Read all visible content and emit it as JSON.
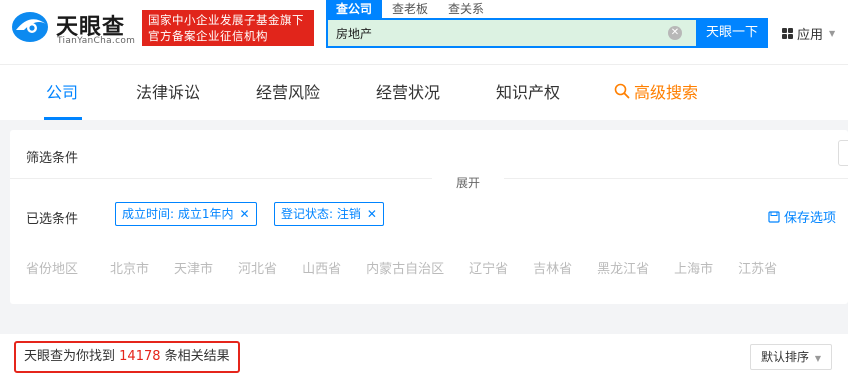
{
  "header": {
    "logo_text": "天眼查",
    "logo_sub": "TianYanCha.com",
    "badge_line1": "国家中小企业发展子基金旗下",
    "badge_line2": "官方备案企业征信机构",
    "search_tabs": [
      {
        "label": "查公司"
      },
      {
        "label": "查老板"
      },
      {
        "label": "查关系"
      }
    ],
    "search_value": "房地产",
    "clear_symbol": "✕",
    "search_button": "天眼一下",
    "apps_label": "应用",
    "apps_caret": "▼"
  },
  "nav": {
    "items": [
      {
        "label": "公司"
      },
      {
        "label": "法律诉讼"
      },
      {
        "label": "经营风险"
      },
      {
        "label": "经营状况"
      },
      {
        "label": "知识产权"
      }
    ],
    "advanced_label": "高级搜索"
  },
  "filter": {
    "title": "筛选条件",
    "selected_label": "已选条件",
    "chips": [
      {
        "label": "成立时间: 成立1年内",
        "x": "✕"
      },
      {
        "label": "登记状态: 注销",
        "x": "✕"
      }
    ],
    "save_label": "保存选项",
    "region_label": "省份地区",
    "regions": [
      "北京市",
      "天津市",
      "河北省",
      "山西省",
      "内蒙古自治区",
      "辽宁省",
      "吉林省",
      "黑龙江省",
      "上海市",
      "江苏省"
    ],
    "expand_label": "展开"
  },
  "results": {
    "prefix": "天眼查为你找到",
    "count": "14178",
    "suffix": "条相关结果",
    "sort_label": "默认排序",
    "sort_caret": "▼"
  },
  "colors": {
    "accent": "#0084ff",
    "badge_red": "#e1251b",
    "advanced_orange": "#ff7f00"
  }
}
